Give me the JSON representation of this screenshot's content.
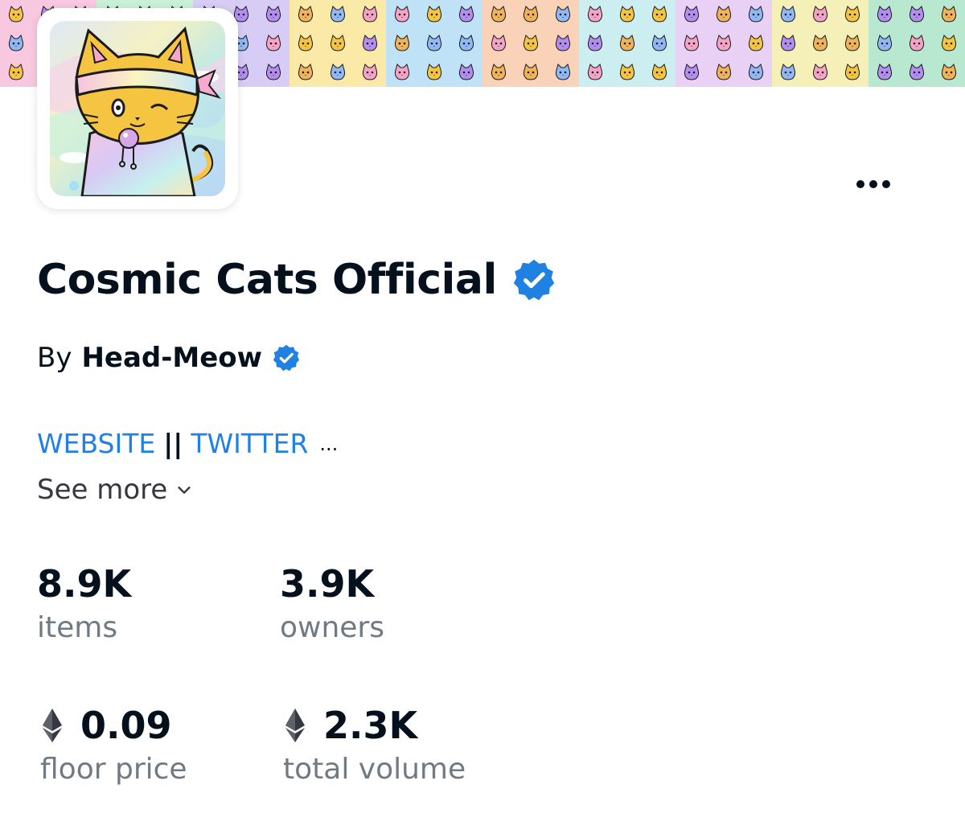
{
  "collection": {
    "title": "Cosmic Cats Official",
    "by_label": "By",
    "creator": "Head-Meow",
    "links": {
      "website": "WEBSITE",
      "separator": "||",
      "twitter": "TWITTER",
      "ellipsis": "..."
    },
    "see_more": "See more"
  },
  "stats": {
    "items": {
      "value": "8.9K",
      "label": "items"
    },
    "owners": {
      "value": "3.9K",
      "label": "owners"
    },
    "floor_price": {
      "value": "0.09",
      "label": "floor price",
      "icon": "ethereum-icon"
    },
    "total_volume": {
      "value": "2.3K",
      "label": "total volume",
      "icon": "ethereum-icon"
    }
  },
  "icons": {
    "verified": "verified-badge-icon",
    "more": "more-horizontal-icon",
    "chevron": "chevron-down-icon"
  },
  "colors": {
    "link": "#2081e2",
    "verified": "#2081e2",
    "text": "#04111d",
    "muted": "#707a83"
  }
}
